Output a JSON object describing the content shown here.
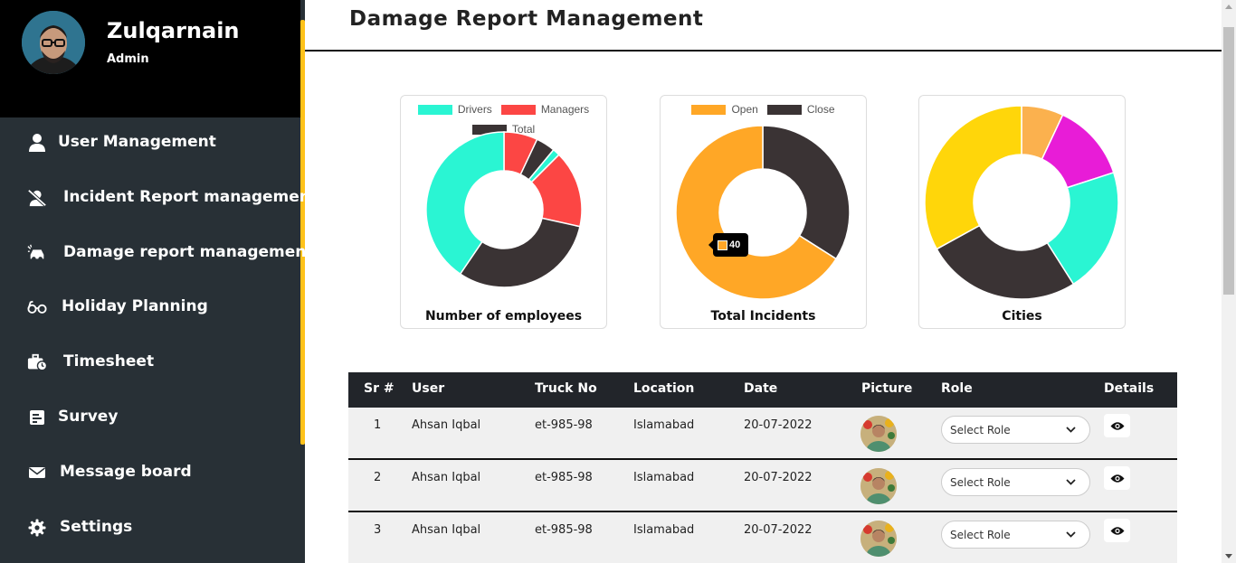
{
  "profile": {
    "name": "Zulqarnain",
    "role": "Admin"
  },
  "sidebar": {
    "items": [
      {
        "label": "User Management",
        "icon": "user-icon"
      },
      {
        "label": "Incident Report management",
        "icon": "user-slash-icon"
      },
      {
        "label": "Damage report management",
        "icon": "car-crash-icon"
      },
      {
        "label": "Holiday Planning",
        "icon": "glasses-icon"
      },
      {
        "label": "Timesheet",
        "icon": "business-time-icon"
      },
      {
        "label": "Survey",
        "icon": "poll-icon"
      },
      {
        "label": "Message board",
        "icon": "envelope-icon"
      },
      {
        "label": "Settings",
        "icon": "gear-icon"
      }
    ]
  },
  "page": {
    "title": "Damage Report Management"
  },
  "colors": {
    "sidebar": "#283036",
    "accent": "#ffc21a",
    "teal": "#2af5d3",
    "red": "#fc4644",
    "dark": "#3a3334",
    "orange": "#ffa726",
    "magenta": "#e81cd7",
    "yellow": "#ffd60a",
    "light_orange": "#fbb14e"
  },
  "chart_data": [
    {
      "type": "pie",
      "title": "Number of employees",
      "legend": [
        "Drivers",
        "Managers",
        "Total"
      ],
      "legend_position": "top",
      "hole": "donut",
      "slices": [
        {
          "value": 7,
          "color": "#fc4644"
        },
        {
          "value": 4,
          "color": "#3a3334"
        },
        {
          "value": 1.5,
          "color": "#2af5d3"
        },
        {
          "value": 16,
          "color": "#fc4644"
        },
        {
          "value": 31,
          "color": "#3a3334"
        },
        {
          "value": 40.5,
          "color": "#2af5d3"
        }
      ]
    },
    {
      "type": "pie",
      "title": "Total Incidents",
      "legend": [
        "Open",
        "Close"
      ],
      "legend_position": "top",
      "hole": "donut",
      "slices": [
        {
          "label": "Close",
          "value": 34,
          "color": "#3a3334"
        },
        {
          "label": "Open",
          "value": 66,
          "color": "#ffa726"
        }
      ],
      "tooltip": {
        "value": "40"
      }
    },
    {
      "type": "pie",
      "title": "Cities",
      "legend_position": "none",
      "hole": "donut",
      "slices": [
        {
          "value": 7,
          "color": "#fbb14e"
        },
        {
          "value": 13,
          "color": "#e81cd7"
        },
        {
          "value": 21,
          "color": "#2af5d3"
        },
        {
          "value": 26,
          "color": "#3a3334"
        },
        {
          "value": 33,
          "color": "#ffd60a"
        }
      ]
    }
  ],
  "table": {
    "headers": [
      "Sr #",
      "User",
      "Truck No",
      "Location",
      "Date",
      "Picture",
      "Role",
      "Details"
    ],
    "rows": [
      {
        "sr": "1",
        "user": "Ahsan Iqbal",
        "truck": "et-985-98",
        "location": "Islamabad",
        "date": "20-07-2022",
        "role": "Select Role"
      },
      {
        "sr": "2",
        "user": "Ahsan Iqbal",
        "truck": "et-985-98",
        "location": "Islamabad",
        "date": "20-07-2022",
        "role": "Select Role"
      },
      {
        "sr": "3",
        "user": "Ahsan Iqbal",
        "truck": "et-985-98",
        "location": "Islamabad",
        "date": "20-07-2022",
        "role": "Select Role"
      }
    ]
  }
}
